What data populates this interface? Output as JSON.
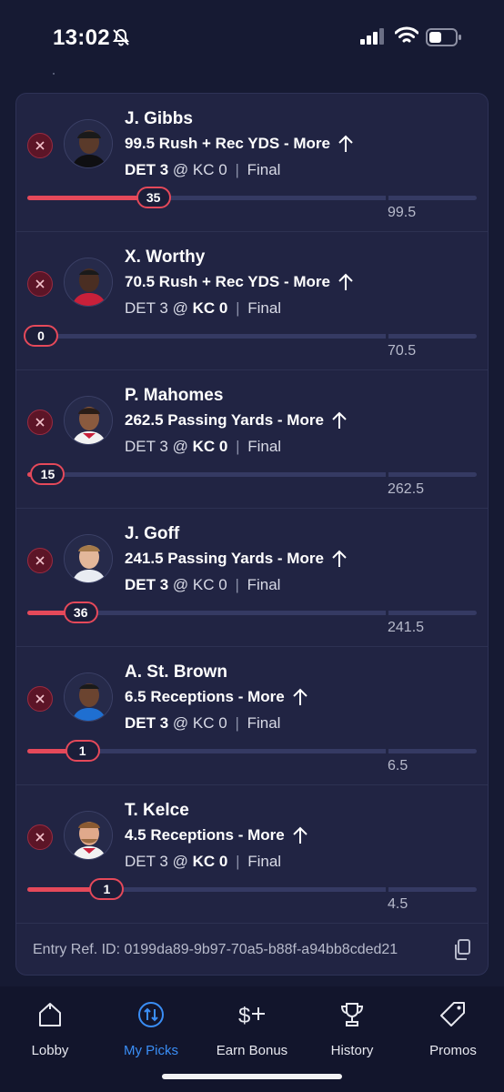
{
  "status_bar": {
    "time": "13:02",
    "bell_icon": "bell-slash-icon",
    "signal_icon": "cellular-signal-icon",
    "wifi_icon": "wifi-icon",
    "battery_icon": "battery-icon"
  },
  "picks": [
    {
      "player": "J. Gibbs",
      "line": "99.5 Rush + Rec YDS - More",
      "away": "DET 3",
      "home": "KC 0",
      "bold_side": "away",
      "status": "Final",
      "current": "35",
      "target": "99.5",
      "progress": 0.352
    },
    {
      "player": "X. Worthy",
      "line": "70.5 Rush + Rec YDS - More",
      "away": "DET 3",
      "home": "KC 0",
      "bold_side": "home",
      "status": "Final",
      "current": "0",
      "target": "70.5",
      "progress": 0.0
    },
    {
      "player": "P. Mahomes",
      "line": "262.5 Passing Yards - More",
      "away": "DET 3",
      "home": "KC 0",
      "bold_side": "home",
      "status": "Final",
      "current": "15",
      "target": "262.5",
      "progress": 0.057
    },
    {
      "player": "J. Goff",
      "line": "241.5 Passing Yards - More",
      "away": "DET 3",
      "home": "KC 0",
      "bold_side": "away",
      "status": "Final",
      "current": "36",
      "target": "241.5",
      "progress": 0.149
    },
    {
      "player": "A. St. Brown",
      "line": "6.5 Receptions - More",
      "away": "DET 3",
      "home": "KC 0",
      "bold_side": "away",
      "status": "Final",
      "current": "1",
      "target": "6.5",
      "progress": 0.154
    },
    {
      "player": "T. Kelce",
      "line": "4.5 Receptions - More",
      "away": "DET 3",
      "home": "KC 0",
      "bold_side": "home",
      "status": "Final",
      "current": "1",
      "target": "4.5",
      "progress": 0.222
    }
  ],
  "entry_ref": "Entry Ref. ID: 0199da89-9b97-70a5-b88f-a94bb8cded21",
  "tabs": [
    {
      "label": "Lobby",
      "icon": "home-icon"
    },
    {
      "label": "My Picks",
      "icon": "swap-arrows-icon"
    },
    {
      "label": "Earn Bonus",
      "icon": "dollar-plus-icon"
    },
    {
      "label": "History",
      "icon": "trophy-icon"
    },
    {
      "label": "Promos",
      "icon": "tag-icon"
    }
  ],
  "active_tab": "My Picks",
  "colors": {
    "accent": "#3a8ef6",
    "progress": "#e5495a",
    "background": "#161a33",
    "card": "#212443"
  }
}
